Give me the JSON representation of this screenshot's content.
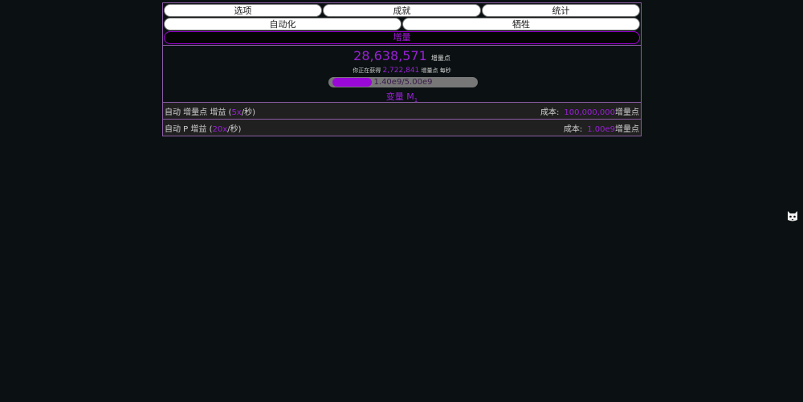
{
  "tabs_row1": [
    "选项",
    "成就",
    "统计"
  ],
  "tabs_row2": [
    "自动化",
    "牺牲"
  ],
  "subtab": "增量",
  "points": {
    "value": "28,638,571",
    "unit": "增量点"
  },
  "rate": {
    "prefix": "你正在获得",
    "value": "2,722,841",
    "unit": "增量点",
    "suffix": "每秒"
  },
  "progress": {
    "text": "1.40e9/5.00e9",
    "fraction": 0.28
  },
  "variable": {
    "label": "变量 M",
    "sub": "1"
  },
  "upgrades": [
    {
      "label_before": "自动 增量点 增益 (",
      "rate": "5x",
      "label_after": "/秒)",
      "cost_label": "成本:",
      "cost_value": "100,000,000",
      "cost_unit": "增量点"
    },
    {
      "label_before": "自动 P 增益 (",
      "rate": "20x",
      "label_after": "/秒)",
      "cost_label": "成本:",
      "cost_value": "1.00e9",
      "cost_unit": "增量点"
    }
  ],
  "colors": {
    "accent": "#9a1fd8",
    "border": "#8b5ca6",
    "background": "#0b1112"
  },
  "icons": {
    "corner": "cat-icon"
  }
}
